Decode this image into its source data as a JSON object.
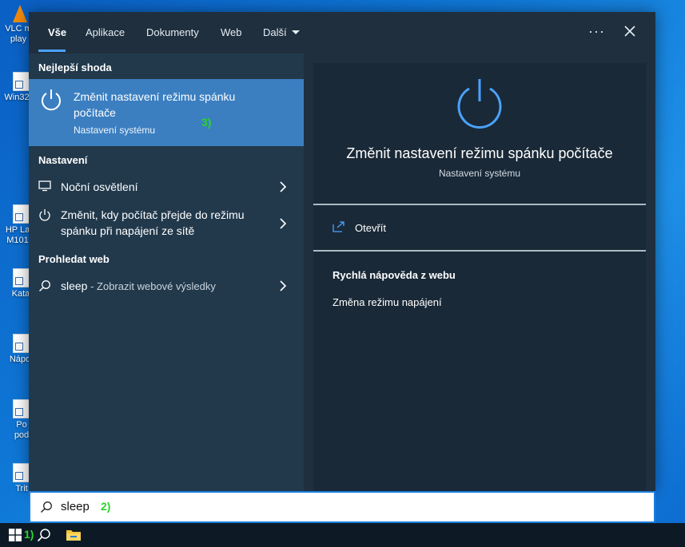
{
  "desktop": {
    "icons": [
      {
        "label": "VLC m\nplay"
      },
      {
        "label": "Win32"
      },
      {
        "label": "HP La\nM101"
      },
      {
        "label": "Kata"
      },
      {
        "label": "Nápo"
      },
      {
        "label": "Po\npod"
      },
      {
        "label": "Trit"
      }
    ]
  },
  "tabs": [
    {
      "label": "Vše"
    },
    {
      "label": "Aplikace"
    },
    {
      "label": "Dokumenty"
    },
    {
      "label": "Web"
    },
    {
      "label": "Další"
    }
  ],
  "header": {
    "more": "···"
  },
  "best_match": {
    "header": "Nejlepší shoda",
    "title": "Změnit nastavení režimu spánku počítače",
    "subtitle": "Nastavení systému",
    "annotation": "3)"
  },
  "settings": {
    "header": "Nastavení",
    "items": [
      {
        "label": "Noční osvětlení",
        "icon": "monitor-icon"
      },
      {
        "label": "Změnit, kdy počítač přejde do režimu spánku při napájení ze sítě",
        "icon": "power-icon"
      }
    ]
  },
  "web": {
    "header": "Prohledat web",
    "query": "sleep",
    "suffix": " - Zobrazit webové výsledky"
  },
  "detail": {
    "title": "Změnit nastavení režimu spánku počítače",
    "subtitle": "Nastavení systému",
    "open_label": "Otevřít",
    "help_title": "Rychlá nápověda z webu",
    "help_item": "Změna režimu napájení"
  },
  "search": {
    "value": "sleep",
    "annotation": "2)"
  },
  "taskbar": {
    "annotation": "1)"
  },
  "colors": {
    "accent": "#3b7fc1",
    "highlight": "#4aa3ff",
    "annotation": "#2bd42b"
  }
}
